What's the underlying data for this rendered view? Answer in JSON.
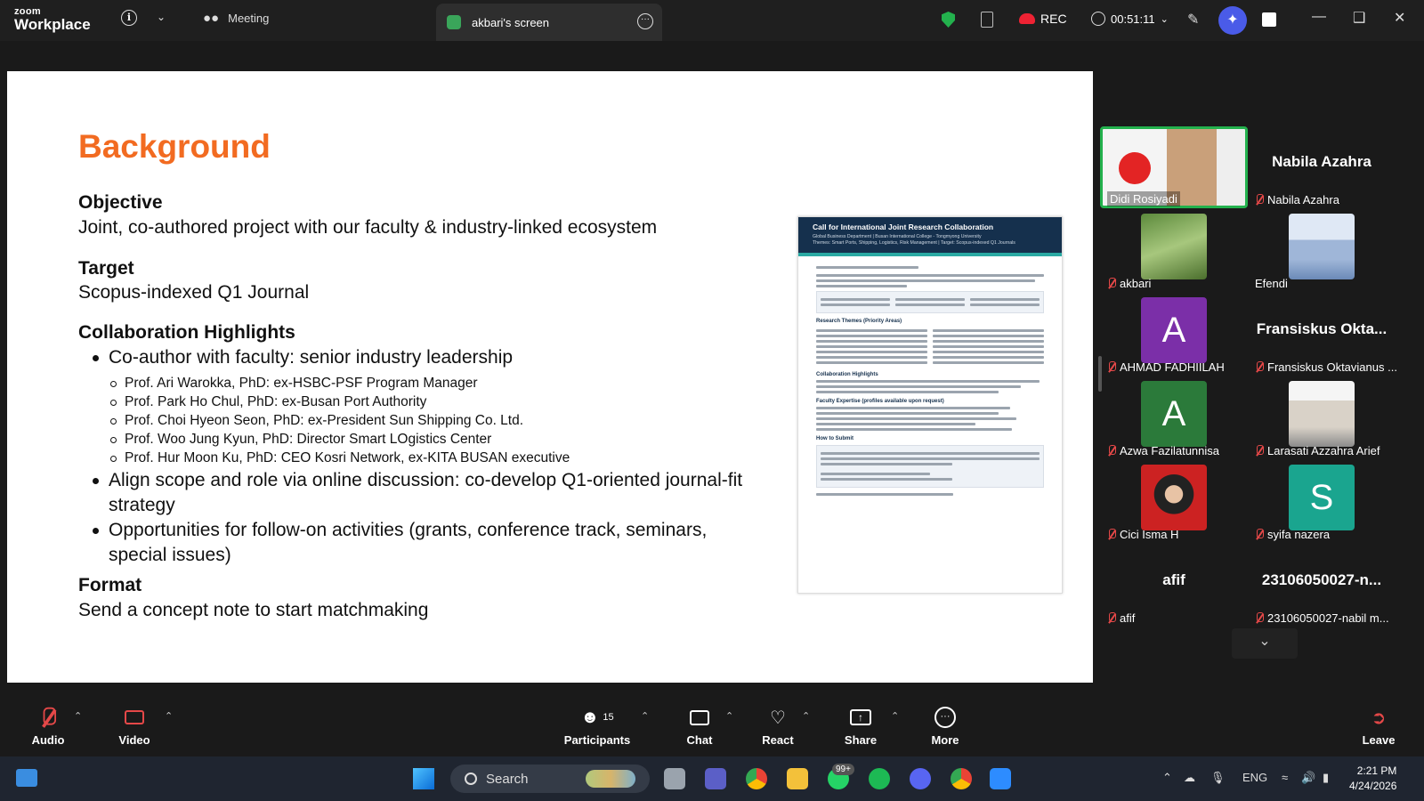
{
  "app": {
    "brand_top": "zoom",
    "brand_bottom": "Workplace",
    "meeting_tab": "Meeting",
    "share_tab": "akbari's screen",
    "rec": "REC",
    "timer": "00:51:11"
  },
  "slide": {
    "title": "Background",
    "objective_h": "Objective",
    "objective_t": "Joint, co-authored project with our faculty & industry-linked ecosystem",
    "target_h": "Target",
    "target_t": "Scopus-indexed Q1 Journal",
    "collab_h": "Collaboration Highlights",
    "bullet1": "Co-author with faculty: senior industry leadership",
    "subs": [
      "Prof. Ari Warokka, PhD: ex-HSBC-PSF Program Manager",
      "Prof. Park Ho Chul, PhD: ex-Busan Port Authority",
      "Prof. Choi Hyeon Seon, PhD: ex-President Sun Shipping Co. Ltd.",
      "Prof. Woo Jung Kyun, PhD: Director Smart LOgistics Center",
      "Prof. Hur Moon Ku, PhD: CEO Kosri Network, ex-KITA BUSAN executive"
    ],
    "bullet2": "Align scope and role via online discussion: co-develop Q1-oriented journal-fit strategy",
    "bullet3": "Opportunities for follow-on activities (grants, conference track, seminars, special issues)",
    "format_h": "Format",
    "format_t": "Send a concept note to start matchmaking",
    "doc_title": "Call for International Joint Research Collaboration",
    "doc_sub1": "Global Business Department | Busan International College - Tongmyong University",
    "doc_sub2": "Themes: Smart Ports, Shipping, Logistics, Risk Management | Target: Scopus-indexed Q1 Journals",
    "doc_h1": "Research Themes (Priority Areas)",
    "doc_h2": "Collaboration Highlights",
    "doc_h3": "Faculty Expertise (profiles available upon request)",
    "doc_h4": "How to Submit"
  },
  "participants": [
    {
      "name": "Didi Rosiyadi",
      "kind": "video",
      "active": true
    },
    {
      "name": "Nabila Azahra",
      "kind": "name",
      "big": "Nabila Azahra"
    },
    {
      "name": "akbari",
      "kind": "video"
    },
    {
      "name": "Efendi",
      "kind": "video"
    },
    {
      "name": "AHMAD FADHIILAH",
      "kind": "letter",
      "letter": "A",
      "color": "#7b2fa8"
    },
    {
      "name": "Fransiskus Oktavianus ...",
      "kind": "name",
      "big": "Fransiskus Okta..."
    },
    {
      "name": "Azwa Fazilatunnisa",
      "kind": "letter",
      "letter": "A",
      "color": "#2b7a3a"
    },
    {
      "name": "Larasati Azzahra Arief",
      "kind": "video"
    },
    {
      "name": "Cici Isma H",
      "kind": "video"
    },
    {
      "name": "syifa nazera",
      "kind": "letter",
      "letter": "S",
      "color": "#1aa58f"
    },
    {
      "name": "afif",
      "kind": "name",
      "big": "afif"
    },
    {
      "name": "23106050027-nabil m...",
      "kind": "name",
      "big": "23106050027-n..."
    }
  ],
  "toolbar": {
    "audio": "Audio",
    "video": "Video",
    "participants": "Participants",
    "participants_count": "15",
    "chat": "Chat",
    "react": "React",
    "share": "Share",
    "more": "More",
    "leave": "Leave"
  },
  "taskbar": {
    "search": "Search",
    "badge": "99+",
    "lang": "ENG",
    "time": "2:21 PM",
    "date": "4/24/2026"
  },
  "colors": {
    "accent": "#f26b21",
    "active_speaker": "#23b14d",
    "muted": "#e54848"
  }
}
